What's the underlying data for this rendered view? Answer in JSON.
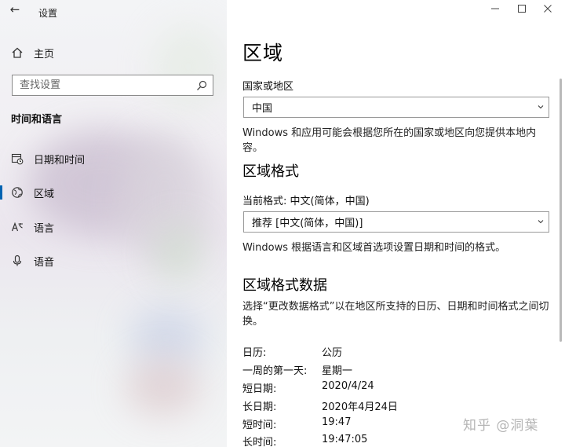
{
  "app": {
    "title": "设置"
  },
  "sidebar": {
    "home_label": "主页",
    "search_placeholder": "查找设置",
    "section_heading": "时间和语言",
    "items": [
      {
        "label": "日期和时间",
        "icon": "calendar-clock-icon",
        "active": false
      },
      {
        "label": "区域",
        "icon": "globe-icon",
        "active": true
      },
      {
        "label": "语言",
        "icon": "language-icon",
        "active": false
      },
      {
        "label": "语音",
        "icon": "microphone-icon",
        "active": false
      }
    ]
  },
  "main": {
    "title": "区域",
    "country": {
      "label": "国家或地区",
      "value": "中国",
      "description": "Windows 和应用可能会根据您所在的国家或地区向您提供本地内容。"
    },
    "format": {
      "heading": "区域格式",
      "current_label": "当前格式: 中文(简体，中国)",
      "value": "推荐 [中文(简体，中国)]",
      "description": "Windows 根据语言和区域首选项设置日期和时间的格式。"
    },
    "format_data": {
      "heading": "区域格式数据",
      "description": "选择“更改数据格式”以在地区所支持的日历、日期和时间格式之间切换。",
      "rows": [
        {
          "label": "日历:",
          "value": "公历"
        },
        {
          "label": "一周的第一天:",
          "value": "星期一"
        },
        {
          "label": "短日期:",
          "value": "2020/4/24"
        },
        {
          "label": "长日期:",
          "value": "2020年4月24日"
        },
        {
          "label": "短时间:",
          "value": "19:47"
        },
        {
          "label": "长时间:",
          "value": "19:47:05"
        }
      ]
    }
  },
  "watermark": "知乎 @洞葉",
  "colors": {
    "accent": "#0063b1"
  }
}
